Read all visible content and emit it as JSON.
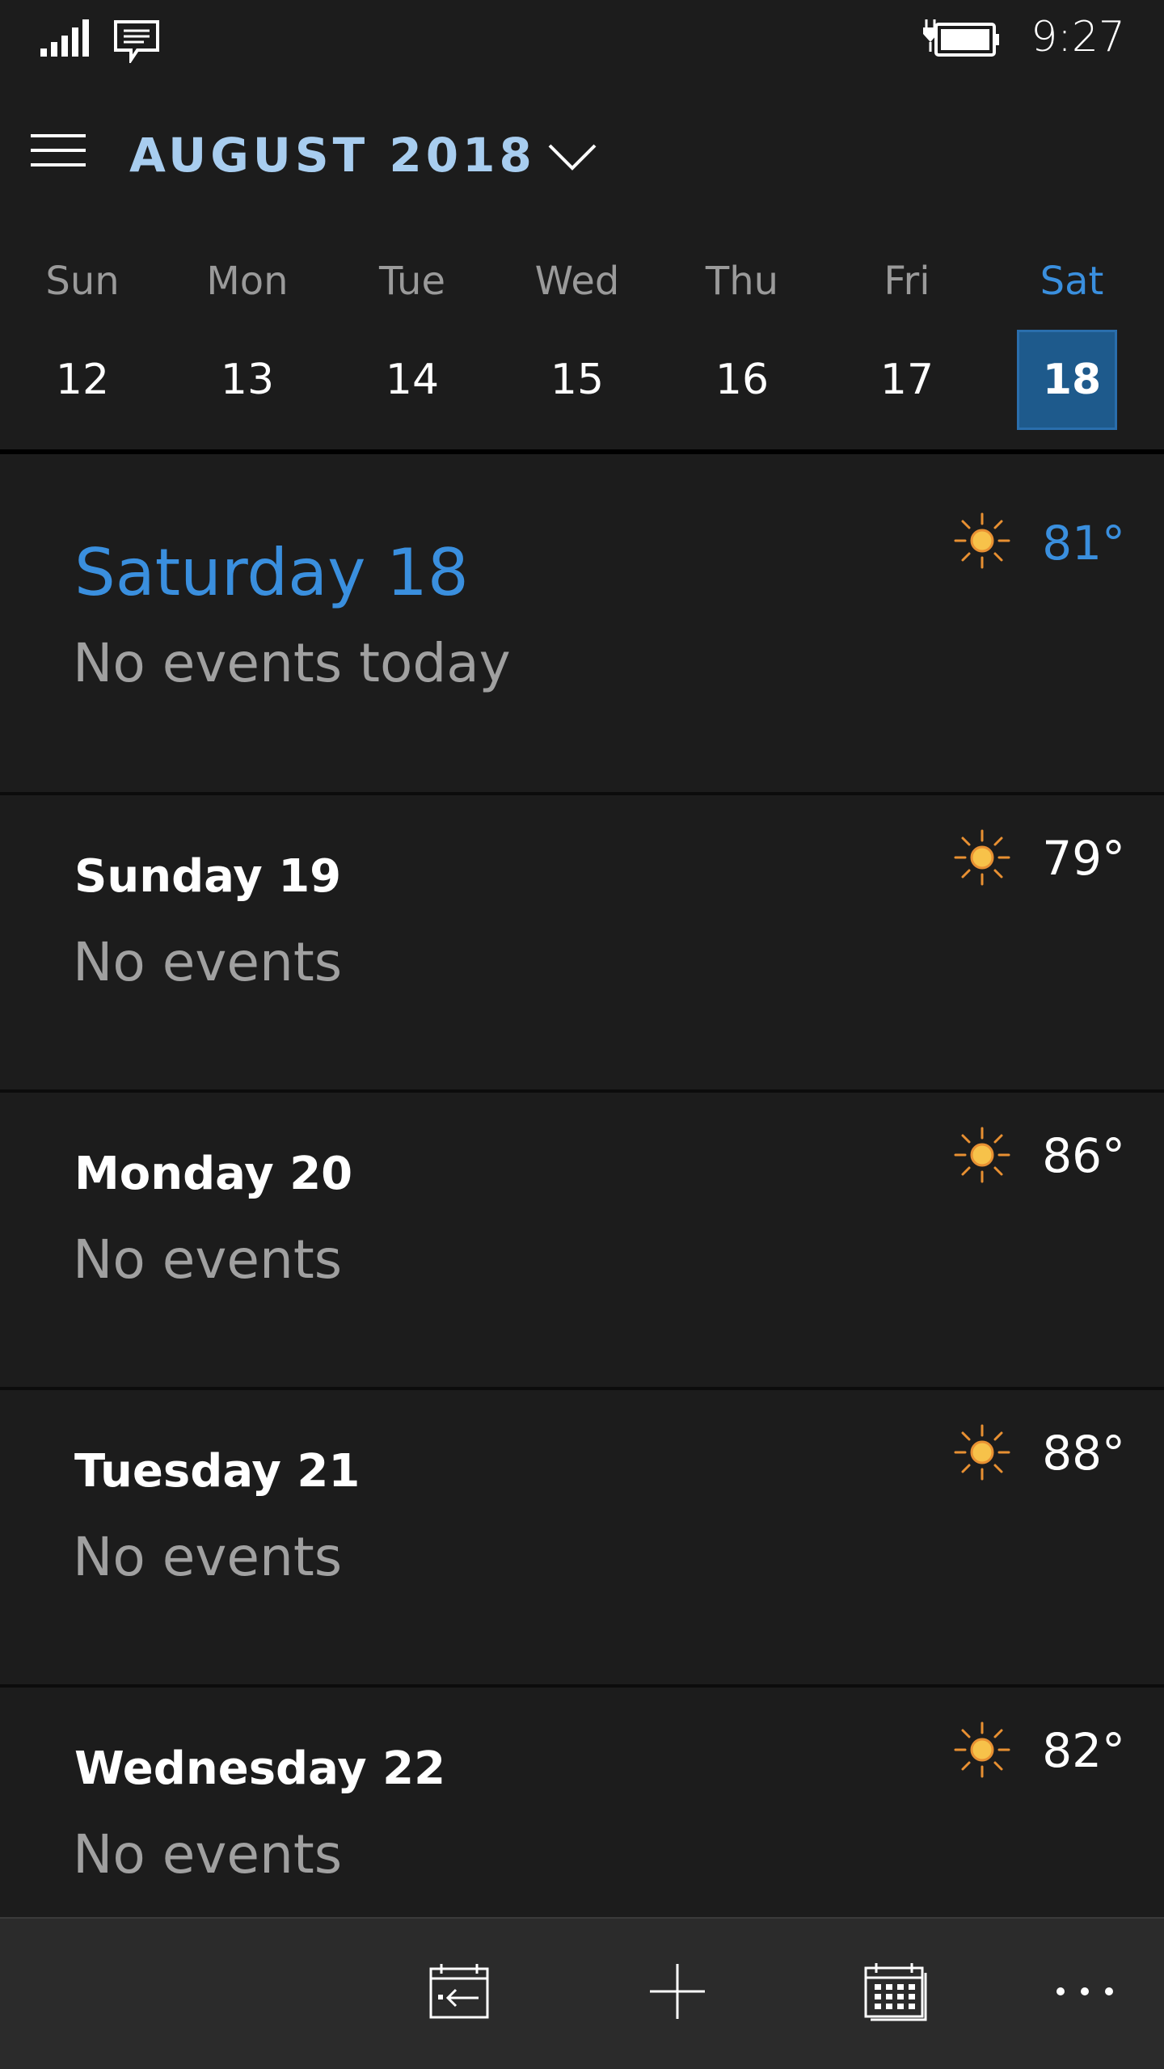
{
  "status_bar": {
    "time": "9:27",
    "icons": [
      "signal-bars-icon",
      "message-icon",
      "battery-charging-icon"
    ]
  },
  "header": {
    "month_title": "AUGUST 2018",
    "menu_icon": "hamburger-icon",
    "dropdown_icon": "chevron-down-icon",
    "title_color": "#a8cdef"
  },
  "week": {
    "days": [
      {
        "name": "Sun",
        "num": "12"
      },
      {
        "name": "Mon",
        "num": "13"
      },
      {
        "name": "Tue",
        "num": "14"
      },
      {
        "name": "Wed",
        "num": "15"
      },
      {
        "name": "Thu",
        "num": "16"
      },
      {
        "name": "Fri",
        "num": "17"
      },
      {
        "name": "Sat",
        "num": "18"
      }
    ],
    "selected_index": 6,
    "selected_color": "#1e5a8c",
    "accent_color": "#3a8fde"
  },
  "agenda": [
    {
      "title": "Saturday 18",
      "events": "No events today",
      "temp": "81°",
      "weather": "sun-icon",
      "today": true
    },
    {
      "title": "Sunday 19",
      "events": "No events",
      "temp": "79°",
      "weather": "sun-icon"
    },
    {
      "title": "Monday 20",
      "events": "No events",
      "temp": "86°",
      "weather": "sun-icon"
    },
    {
      "title": "Tuesday 21",
      "events": "No events",
      "temp": "88°",
      "weather": "sun-icon"
    },
    {
      "title": "Wednesday 22",
      "events": "No events",
      "temp": "82°",
      "weather": "sun-icon"
    }
  ],
  "app_bar": {
    "buttons": [
      "today-icon",
      "add-icon",
      "calendar-view-icon",
      "more-icon"
    ]
  }
}
